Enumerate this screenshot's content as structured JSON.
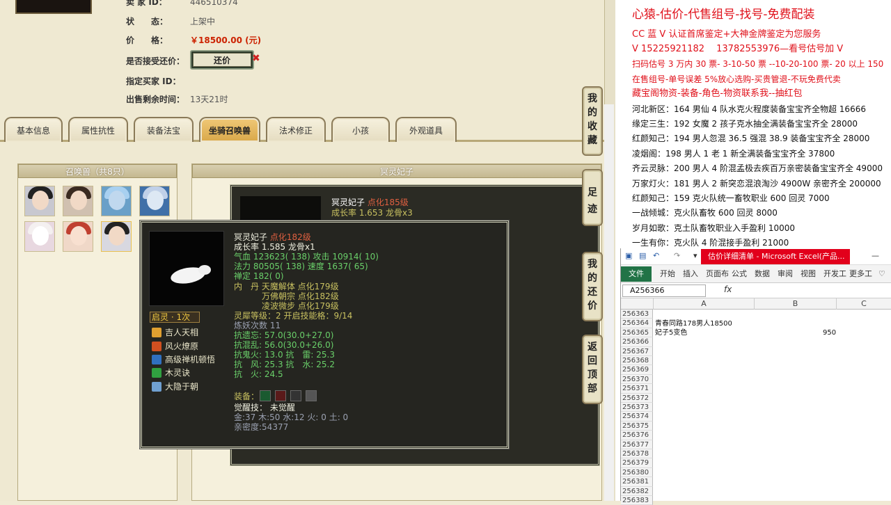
{
  "seller": {
    "id_label": "卖 家 ID：",
    "id_value": "446510374",
    "status_label": "状　　态：",
    "status_value": "上架中",
    "price_label": "价　　格：",
    "price_value": "￥18500.00 (元)",
    "counter_label": "是否接受还价：",
    "counter_button": "还价",
    "buyer_label": "指定买家 ID：",
    "remaining_label": "出售剩余时间：",
    "remaining_value": "13天21时"
  },
  "tabs": [
    "基本信息",
    "属性抗性",
    "装备法宝",
    "坐骑召唤兽",
    "法术修正",
    "小孩",
    "外观道具"
  ],
  "active_tab": "坐骑召唤兽",
  "summon_panel_title": "召唤兽（共8只）",
  "detail_panel_title": "冥灵妃子",
  "bg_card": {
    "name": "冥灵妃子",
    "tag": "点化185级",
    "growth": "成长率 1.653 龙骨x3"
  },
  "tooltip": {
    "name": "冥灵妃子",
    "tag": "点化182级",
    "growth": "成长率 1.585 龙骨x1",
    "hp_line": "气血 123623( 138) 攻击 10914( 10)",
    "mp_line": "法力 80505( 138) 速度 1637( 65)",
    "chan": "禅定 182( 0)",
    "neidan_label": "内　丹",
    "neidan_1": "天魔解体 点化179级",
    "neidan_2": "万佛朝宗 点化182级",
    "neidan_3": "凌波微步 点化179级",
    "lingxi": "灵犀等级：2 开启技能格：9/14",
    "lianyao": "炼妖次数 11",
    "res_1": "抗遗忘: 57.0(30.0+27.0)",
    "res_2": "抗混乱: 56.0(30.0+26.0)",
    "res_3": "抗鬼火: 13.0 抗　雷: 25.3",
    "res_4": "抗　风: 25.3 抗　水: 25.2",
    "res_5": "抗　火: 24.5",
    "equip_label": "装备：",
    "awaken": "觉醒技： 未觉醒",
    "elements": "金:37 木:50 水:12 火: 0 土: 0",
    "intimacy": "亲密度:54377",
    "qiling": "启灵 · 1次",
    "skills": [
      "吉人天相",
      "风火燎原",
      "高级禅机顿悟",
      "木灵诀",
      "大隐于朝"
    ]
  },
  "side_buttons": [
    "我的收藏",
    "足迹",
    "我的还价",
    "返回顶部"
  ],
  "right_panel": {
    "headline": "心猿-估价-代售组号-找号-免费配装",
    "lines": [
      "CC 蓝 V 认证首席鉴定+大神金牌鉴定为您服务",
      "V 15225921182　 13782553976—看号估号加 V",
      "扫码估号 3 万内 30 票- 3-10-50 票 --10-20-100 票- 20 以上 150",
      "在售组号-单号误差 5%放心选购-买贵管退-不玩免费代卖",
      "藏宝阁物资-装备-角色-物资联系我--抽红包"
    ],
    "listings": [
      "河北新区：164 男仙 4 队水克火程度装备宝宝齐全物超 16666",
      "缘定三生：192 女魔 2 孩子克水抽全满装备宝宝齐全 28000",
      "红颜知己：194 男人忽混 36.5 强混 38.9 装备宝宝齐全 28000",
      "凌烟阁：198 男人 1 老 1 新全满装备宝宝齐全 37800",
      "齐云灵脉：200 男人 4 阶混孟极去疾百万亲密装备宝宝齐全 49000",
      "万家灯火：181 男人 2 新突恋混浪淘沙 4900W 亲密齐全 200000",
      "红颜知己：159 克火队统一畜牧职业 600 回灵 7000",
      "一战倾城：克火队畜牧 600 回灵 8000",
      "岁月如歌：克土队畜牧职业入手盈利 10000",
      "一生有你：克火队 4 阶混接手盈利 21000"
    ]
  },
  "excel": {
    "title": "估价详细清单 - Microsoft Excel(产品...",
    "ribbon_file": "文件",
    "ribbon_tabs": [
      "开始",
      "插入",
      "页面布",
      "公式",
      "数据",
      "审阅",
      "视图",
      "开发工",
      "更多工"
    ],
    "name_box": "A256366",
    "fx": "fx",
    "columns": [
      "A",
      "B",
      "C"
    ],
    "rows": [
      "256363",
      "256364",
      "256365",
      "256366",
      "256367",
      "256368",
      "256369",
      "256370",
      "256371",
      "256372",
      "256373",
      "256374",
      "256375",
      "256376",
      "256377",
      "256378",
      "256379",
      "256380",
      "256381",
      "256382",
      "256383"
    ],
    "cell_256364_A": "青春同路178男人18500",
    "cell_256365_A": "妃子5变色",
    "cell_256365_B": "950"
  },
  "colors": {
    "price": "#cc2200",
    "headline": "#e0101a",
    "excel_title": "#e2001b",
    "excel_file": "#217346",
    "active_tab": "#e0b05a"
  }
}
